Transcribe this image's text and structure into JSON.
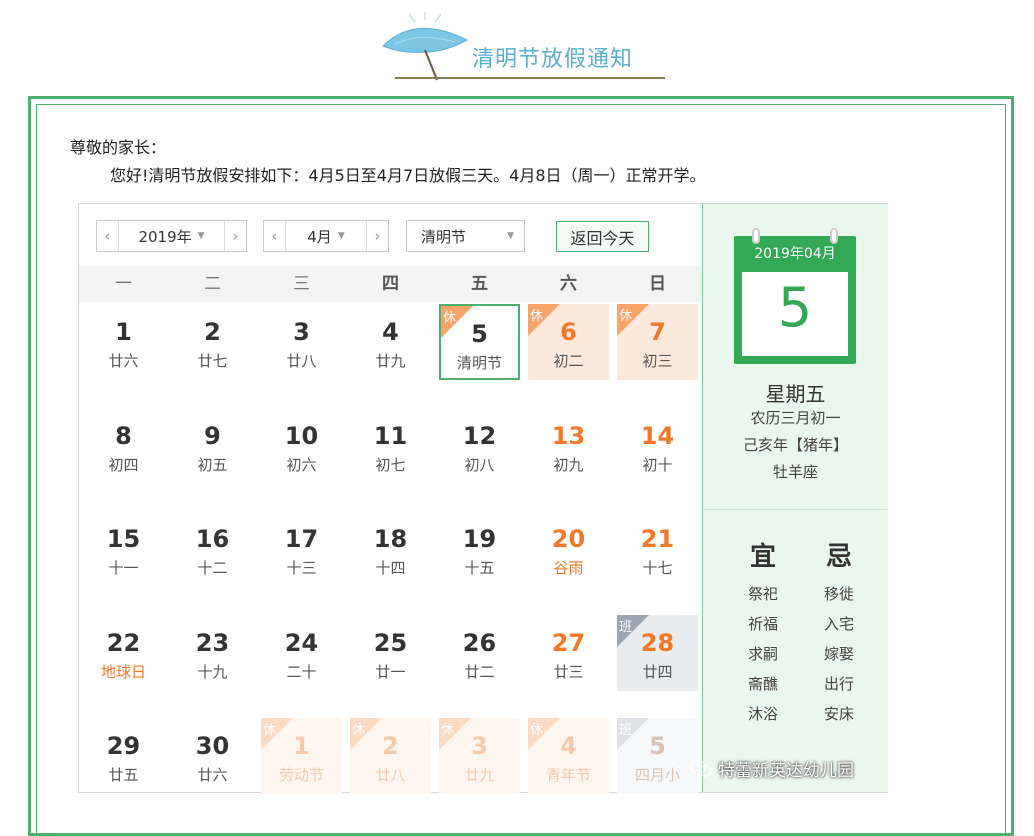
{
  "header": {
    "title": "清明节放假通知"
  },
  "letter": {
    "greeting": "尊敬的家长：",
    "body": "您好!清明节放假安排如下：4月5日至4月7日放假三天。4月8日（周一）正常开学。"
  },
  "calendar": {
    "year_select": "2019年",
    "month_select": "4月",
    "holiday_select": "清明节",
    "today_button": "返回今天",
    "weekdays": [
      "一",
      "二",
      "三",
      "四",
      "五",
      "六",
      "日"
    ],
    "tag_rest": "休",
    "tag_work": "班",
    "rows": [
      [
        {
          "d": "1",
          "l": "廿六"
        },
        {
          "d": "2",
          "l": "廿七"
        },
        {
          "d": "3",
          "l": "廿八"
        },
        {
          "d": "4",
          "l": "廿九"
        },
        {
          "d": "5",
          "l": "清明节"
        },
        {
          "d": "6",
          "l": "初二"
        },
        {
          "d": "7",
          "l": "初三"
        }
      ],
      [
        {
          "d": "8",
          "l": "初四"
        },
        {
          "d": "9",
          "l": "初五"
        },
        {
          "d": "10",
          "l": "初六"
        },
        {
          "d": "11",
          "l": "初七"
        },
        {
          "d": "12",
          "l": "初八"
        },
        {
          "d": "13",
          "l": "初九"
        },
        {
          "d": "14",
          "l": "初十"
        }
      ],
      [
        {
          "d": "15",
          "l": "十一"
        },
        {
          "d": "16",
          "l": "十二"
        },
        {
          "d": "17",
          "l": "十三"
        },
        {
          "d": "18",
          "l": "十四"
        },
        {
          "d": "19",
          "l": "十五"
        },
        {
          "d": "20",
          "l": "谷雨"
        },
        {
          "d": "21",
          "l": "十七"
        }
      ],
      [
        {
          "d": "22",
          "l": "地球日"
        },
        {
          "d": "23",
          "l": "十九"
        },
        {
          "d": "24",
          "l": "二十"
        },
        {
          "d": "25",
          "l": "廿一"
        },
        {
          "d": "26",
          "l": "廿二"
        },
        {
          "d": "27",
          "l": "廿三"
        },
        {
          "d": "28",
          "l": "廿四"
        }
      ],
      [
        {
          "d": "29",
          "l": "廿五"
        },
        {
          "d": "30",
          "l": "廿六"
        },
        {
          "d": "1",
          "l": "劳动节"
        },
        {
          "d": "2",
          "l": "廿八"
        },
        {
          "d": "3",
          "l": "廿九"
        },
        {
          "d": "4",
          "l": "青年节"
        },
        {
          "d": "5",
          "l": "四月小"
        }
      ]
    ],
    "detail": {
      "pad_header": "2019年04月",
      "day": "5",
      "weekday": "星期五",
      "lunar": "农历三月初一",
      "ganzhi": "己亥年【猪年】",
      "zodiac_sign": "牡羊座",
      "yi_title": "宜",
      "ji_title": "忌",
      "yi_items": [
        "祭祀",
        "祈福",
        "求嗣",
        "斋醮",
        "沐浴"
      ],
      "ji_items": [
        "移徙",
        "入宅",
        "嫁娶",
        "出行",
        "安床"
      ]
    }
  },
  "watermark": "特蕾新英达幼儿园",
  "colors": {
    "accent_green": "#4fb06e",
    "holiday_orange": "#f07828",
    "title_blue": "#5aaed0"
  }
}
